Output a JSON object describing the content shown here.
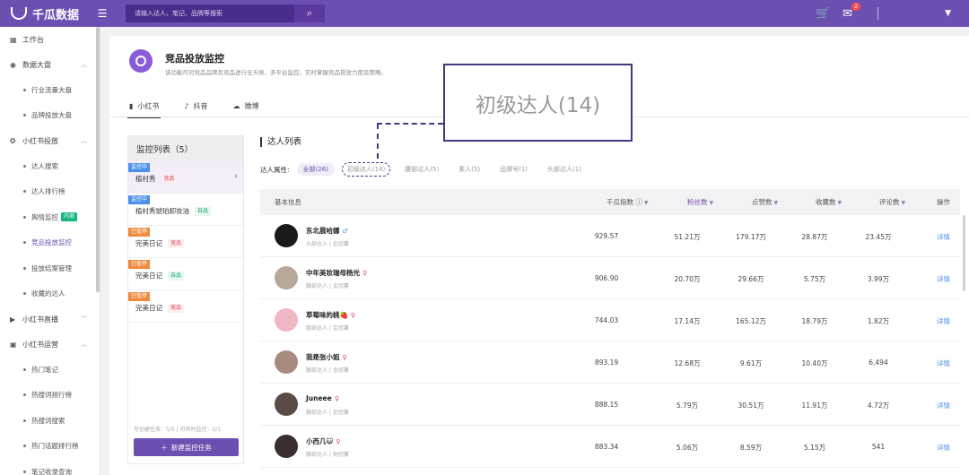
{
  "app": {
    "name": "千瓜数据"
  },
  "search": {
    "placeholder": "请输入达人、笔记、品牌等搜索"
  },
  "header": {
    "mail_count": "2"
  },
  "sidebar": {
    "workbench": "工作台",
    "groups": [
      {
        "label": "数据大盘",
        "items": [
          "行业流量大盘",
          "品牌投放大盘"
        ]
      },
      {
        "label": "小红书投放",
        "items": [
          "达人搜索",
          "达人排行榜",
          "舆情监控",
          "竞品投放监控",
          "投放结案管理",
          "收藏的达人"
        ],
        "new_tag": "内测"
      },
      {
        "label": "小红书直播"
      },
      {
        "label": "小红书运营",
        "items": [
          "热门笔记",
          "热搜词排行榜",
          "热搜词搜索",
          "热门话题排行榜",
          "笔记收录查询"
        ]
      }
    ]
  },
  "page": {
    "title": "竞品投放监控",
    "description": "该功能可对竞品品牌及竞品进行全天候、多平台监控，实时掌握竞品投放力度及策略。",
    "tabs": [
      "小红书",
      "抖音",
      "微博"
    ]
  },
  "monitor": {
    "title": "监控列表（5）",
    "items": [
      {
        "status": "监控中",
        "name": "植村秀",
        "tag": "竞品"
      },
      {
        "status": "监控中",
        "name": "植村秀琥珀卸妆油",
        "tag": "自品"
      },
      {
        "status": "已暂停",
        "name": "完美日记",
        "tag": "竞品"
      },
      {
        "status": "已暂停",
        "name": "完美日记",
        "tag": "自品"
      },
      {
        "status": "已暂停",
        "name": "完美日记",
        "tag": "竞品"
      }
    ],
    "limit_text": "可创建任务：5/5 | 可同时监控：2/1",
    "new_task_label": "新建监控任务"
  },
  "influencers": {
    "title": "达人列表",
    "filter_label": "达人属性:",
    "filters": [
      "全部(26)",
      "初级达人(14)",
      "腰部达人(5)",
      "素人(5)",
      "品牌号(1)",
      "头部达人(1)"
    ],
    "columns": {
      "basic": "基本信息",
      "index": "千瓜指数",
      "fans": "粉丝数",
      "likes": "点赞数",
      "collects": "收藏数",
      "comments": "评论数",
      "action": "操作"
    },
    "detail_label": "详情",
    "rows": [
      {
        "name": "东北晨哈娜",
        "gender": "♂",
        "sub": "头部达人 | 金冠薯",
        "index": "929.57",
        "fans": "51.21万",
        "likes": "179.17万",
        "collects": "28.87万",
        "comments": "23.45万",
        "avatar_color": "#1a1a1a"
      },
      {
        "name": "中年美妆瑞母杨光",
        "gender": "♀",
        "sub": "腰部达人 | 金冠薯",
        "index": "906.90",
        "fans": "20.70万",
        "likes": "29.66万",
        "collects": "5.75万",
        "comments": "3.99万",
        "avatar_color": "#b8a89a"
      },
      {
        "name": "草莓味的桃🍓",
        "gender": "♀",
        "sub": "腰部达人 | 金冠薯",
        "index": "744.03",
        "fans": "17.14万",
        "likes": "165.12万",
        "collects": "18.79万",
        "comments": "1.82万",
        "avatar_color": "#f0b8c4"
      },
      {
        "name": "我是张小姐",
        "gender": "♀",
        "sub": "腰部达人 | 金冠薯",
        "index": "893.19",
        "fans": "12.68万",
        "likes": "9.61万",
        "collects": "10.40万",
        "comments": "6,494",
        "avatar_color": "#a98a7e"
      },
      {
        "name": "Juneee",
        "gender": "♀",
        "sub": "腰部达人 | 金冠薯",
        "index": "888.15",
        "fans": "5.79万",
        "likes": "30.51万",
        "collects": "11.91万",
        "comments": "4.72万",
        "avatar_color": "#5a4a48"
      },
      {
        "name": "小西几😺",
        "gender": "♀",
        "sub": "腰部达人 | 铜冠薯",
        "index": "883.34",
        "fans": "5.06万",
        "likes": "8.59万",
        "collects": "5.15万",
        "comments": "541",
        "avatar_color": "#3a2e2e"
      }
    ]
  },
  "callout": {
    "text": "初级达人(14)"
  },
  "colors": {
    "brand": "#6d4fb1",
    "accent_blue": "#4a8fe8",
    "callout_border": "#4a3580"
  }
}
